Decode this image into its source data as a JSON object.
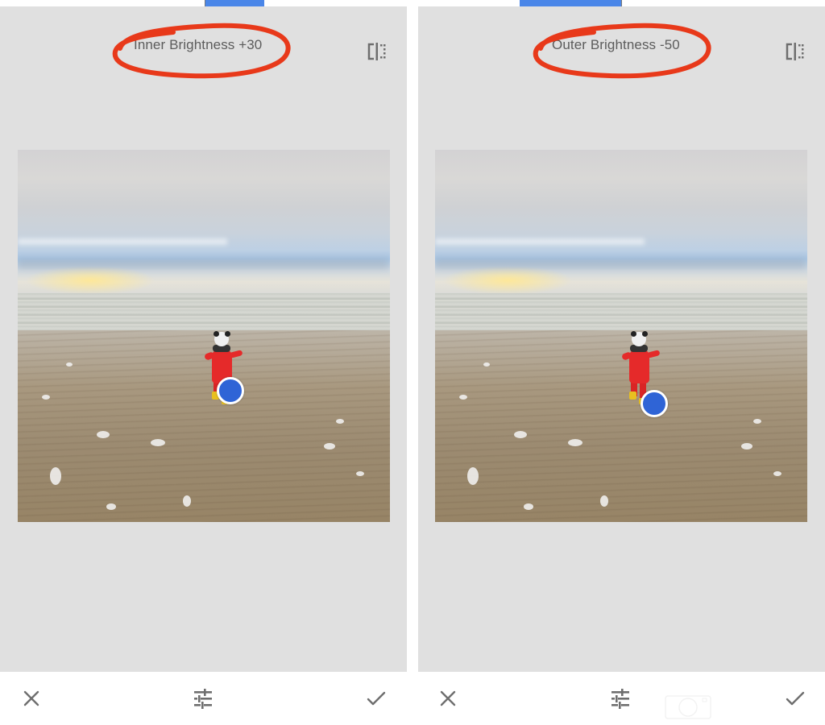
{
  "panels": [
    {
      "id": "inner-brightness",
      "title": "Inner Brightness +30",
      "adjustment": {
        "parameter": "Inner Brightness",
        "value": 30
      },
      "compare_icon": "compare-split-icon",
      "image": {
        "description": "Child in red suit running on wet beach toward the sea under cloudy sky"
      },
      "control_point": {
        "color": "#2f64d6"
      },
      "annotation_color": "#e8391a",
      "bottom_bar": {
        "cancel_icon": "close-icon",
        "tune_icon": "tune-sliders-icon",
        "apply_icon": "checkmark-icon"
      }
    },
    {
      "id": "outer-brightness",
      "title": "Outer Brightness -50",
      "adjustment": {
        "parameter": "Outer Brightness",
        "value": -50
      },
      "compare_icon": "compare-split-icon",
      "image": {
        "description": "Child in red suit running on wet beach toward the sea under cloudy sky"
      },
      "control_point": {
        "color": "#2f64d6"
      },
      "annotation_color": "#e8391a",
      "bottom_bar": {
        "cancel_icon": "close-icon",
        "tune_icon": "tune-sliders-icon",
        "apply_icon": "checkmark-icon"
      }
    }
  ],
  "colors": {
    "panel_background": "#e0e0e0",
    "accent_blue": "#4a86e8",
    "icon_gray": "#6e6e6e",
    "text_gray": "#5c5c5c"
  },
  "watermark": {
    "icon": "camera-icon"
  }
}
